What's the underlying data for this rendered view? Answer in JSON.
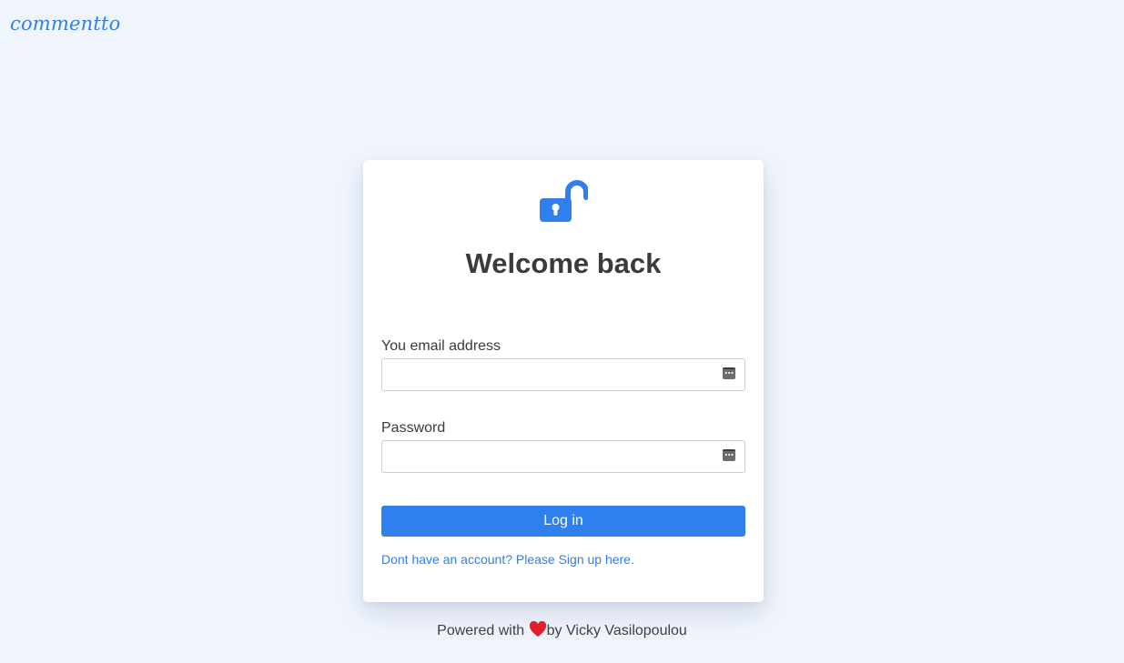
{
  "brand": {
    "name": "commentto"
  },
  "login": {
    "icon": "unlock-icon",
    "title": "Welcome back",
    "email_label": "You email address",
    "email_value": "",
    "password_label": "Password",
    "password_value": "",
    "submit_label": "Log in",
    "signup_text": "Dont have an account? Please Sign up here."
  },
  "footer": {
    "prefix": "Powered with ",
    "icon": "heart-icon",
    "suffix": "by Vicky Vasilopoulou"
  },
  "colors": {
    "accent": "#2f80ed",
    "background": "#f0f5fd",
    "card": "#ffffff",
    "heart": "#e0202a"
  }
}
